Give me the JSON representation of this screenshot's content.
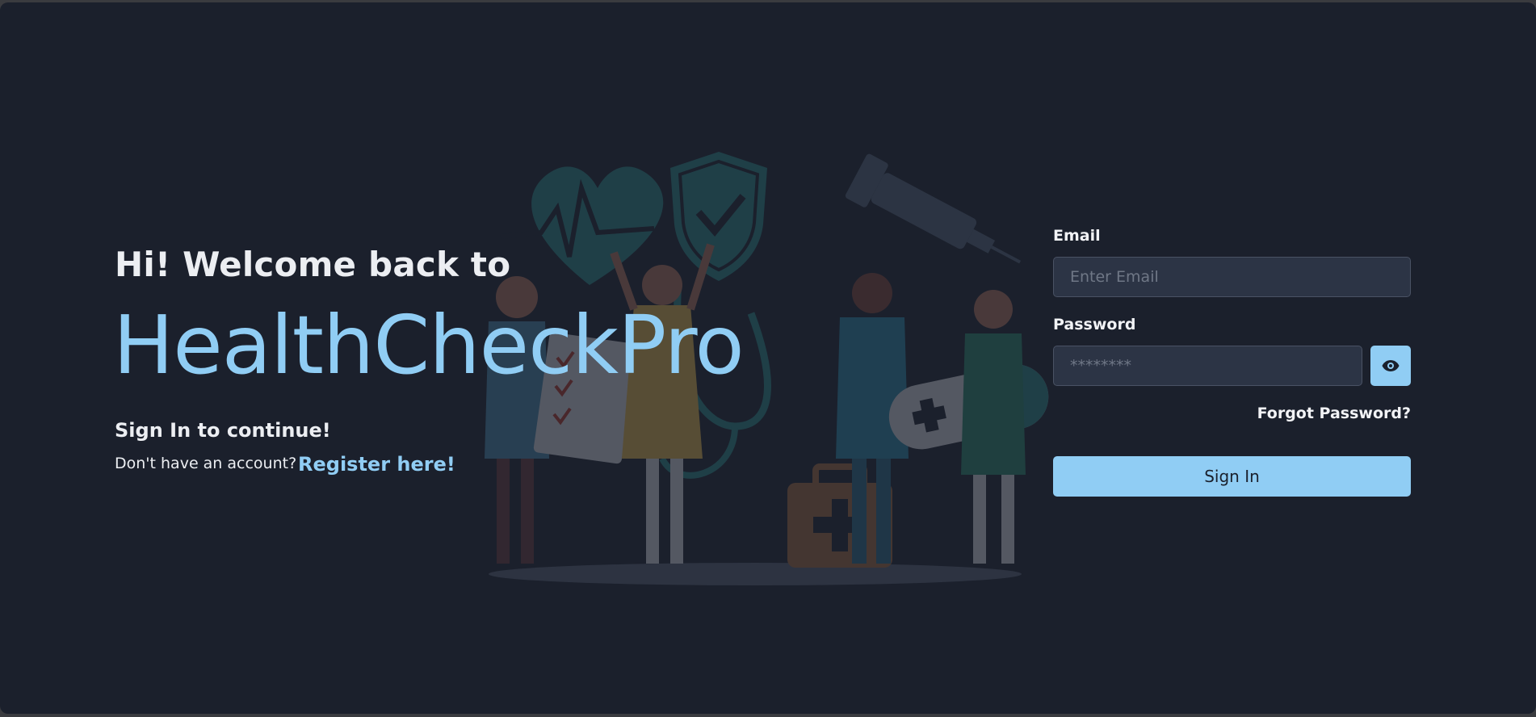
{
  "hero": {
    "welcome": "Hi! Welcome back to",
    "brand": "HealthCheckPro",
    "subtitle": "Sign In to continue!",
    "no_account": "Don't have an account?",
    "register_link": "Register here!"
  },
  "form": {
    "email_label": "Email",
    "email_placeholder": "Enter Email",
    "password_label": "Password",
    "password_placeholder": "********",
    "show_password_icon": "eye-icon",
    "forgot_link": "Forgot Password?",
    "submit_label": "Sign In"
  },
  "colors": {
    "background": "#1b202c",
    "accent": "#90cdf4",
    "input_bg": "#2c3445",
    "text": "#eceef2"
  },
  "illustration": {
    "icons": [
      "heart-pulse-icon",
      "shield-check-icon",
      "syringe-icon",
      "stethoscope-icon",
      "first-aid-kit-icon",
      "medicine-capsule-icon",
      "clipboard-icon"
    ]
  }
}
